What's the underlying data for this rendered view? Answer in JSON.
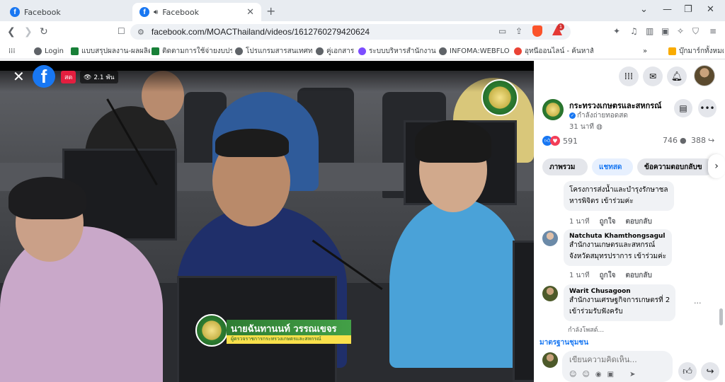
{
  "browser": {
    "tabs": [
      {
        "label": "Facebook",
        "active": false
      },
      {
        "label": "Facebook",
        "active": true
      }
    ],
    "url": "facebook.com/MOACThailand/videos/1612760279420624",
    "bookmarks": [
      {
        "label": "Login",
        "color": "#5f6368"
      },
      {
        "label": "แบบสรุปผลงาน-ผลผลิต...",
        "color": "#188038"
      },
      {
        "label": "ติดตามการใช้จ่ายงบประ...",
        "color": "#188038"
      },
      {
        "label": "โปรแกรมสารสนเทศทรั...",
        "color": "#5f6368"
      },
      {
        "label": "คู่เอกสาร",
        "color": "#5f6368"
      },
      {
        "label": "ระบบบริหารสำนักงานอั...",
        "color": "#7c4dff"
      },
      {
        "label": "INFOMA:WEBFLOW",
        "color": "#5f6368"
      },
      {
        "label": "อุทนีออนไลน์ - ค้นหาสั...",
        "color": "#ea4335"
      }
    ],
    "bookmarks_folder": "บุ๊กมาร์กทั้งหมด"
  },
  "video": {
    "live_label": "สด",
    "viewers": "2.1 พัน",
    "lower_third_name": "นายฉันทานนท์ วรรณเขจร",
    "lower_third_title": "ผู้ตรวจราชการกระทรวงเกษตรและสหกรณ์"
  },
  "post": {
    "page_name": "กระทรวงเกษตรและสหกรณ์",
    "status": "กำลังถ่ายทอดสด",
    "time": "31 นาที",
    "reactions_count": "591",
    "comments_count": "746",
    "shares_count": "388",
    "tabs": [
      "ภาพรวม",
      "แชทสด",
      "ข้อความตอบกลับข"
    ]
  },
  "comments": [
    {
      "name": "",
      "lines": [
        "โครงการส่งน้ำและบำรุงรักษาชล",
        "หารพิจิตร เข้าร่วมค่ะ"
      ],
      "time": "1 นาที",
      "like": "ถูกใจ",
      "reply": "ตอบกลับ"
    },
    {
      "name": "Natchuta Khamthongsagul",
      "lines": [
        "สำนักงานเกษตรและสหกรณ์",
        "จังหวัดสมุทรปราการ เข้าร่วมค่ะ"
      ],
      "time": "1 นาที",
      "like": "ถูกใจ",
      "reply": "ตอบกลับ"
    },
    {
      "name": "Warit Chusagoon",
      "lines": [
        "สำนักงานเศรษฐกิจการเกษตรที่ 2",
        "เข้าร่วมรับฟังครับ"
      ],
      "time": "",
      "like": "",
      "reply": ""
    }
  ],
  "typing_label": "กำลังโพสต์...",
  "section_title": "มาตรฐานชุมชน",
  "compose_placeholder": "เขียนความคิดเห็น...",
  "icons": {
    "menu": "grid-icon",
    "messenger": "messenger-icon",
    "notifications": "bell-icon"
  }
}
